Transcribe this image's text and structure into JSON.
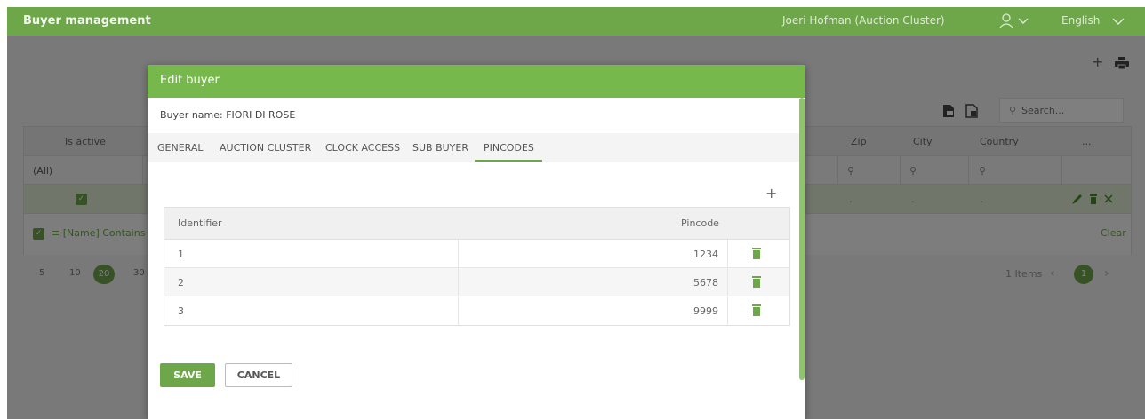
{
  "app": {
    "title": "Buyer management",
    "user_name": "Joeri Hofman (Auction Cluster)",
    "language": "English"
  },
  "toolbar": {
    "search_placeholder": "Search..."
  },
  "grid": {
    "columns": [
      "Is active",
      "Zip",
      "City",
      "Country",
      "..."
    ],
    "filter_all": "(All)",
    "row": {
      "zip": ".",
      "city": ".",
      "country": "."
    },
    "filter_summary": "[Name] Contains '",
    "clear_label": "Clear"
  },
  "pager": {
    "sizes": [
      "5",
      "10",
      "20",
      "30"
    ],
    "active_size": "20",
    "items_text": "1 Items",
    "current_page": "1"
  },
  "modal": {
    "title": "Edit buyer",
    "buyer_name": "Buyer name: FIORI DI ROSE",
    "tabs": [
      "GENERAL",
      "AUCTION CLUSTER",
      "CLOCK ACCESS",
      "SUB BUYER",
      "PINCODES"
    ],
    "active_tab": "PINCODES",
    "add_symbol": "+",
    "table": {
      "headers": {
        "identifier": "Identifier",
        "pincode": "Pincode"
      },
      "rows": [
        {
          "identifier": "1",
          "pincode": "1234"
        },
        {
          "identifier": "2",
          "pincode": "5678"
        },
        {
          "identifier": "3",
          "pincode": "9999"
        }
      ]
    },
    "save_label": "SAVE",
    "cancel_label": "CANCEL"
  },
  "colors": {
    "brand_green": "#6ea64a",
    "header_green": "#77b84c"
  }
}
